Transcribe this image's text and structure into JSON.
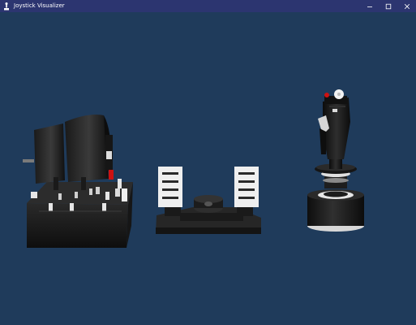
{
  "window": {
    "title": "Joystick Visualizer",
    "icon": "joystick-icon",
    "controls": {
      "minimize_icon": "minimize-icon",
      "maximize_icon": "maximize-icon",
      "close_icon": "close-icon"
    }
  },
  "scene": {
    "background_color": "#1f3b5b",
    "models": [
      "throttle-quadrant",
      "rudder-pedals",
      "flight-stick"
    ]
  }
}
